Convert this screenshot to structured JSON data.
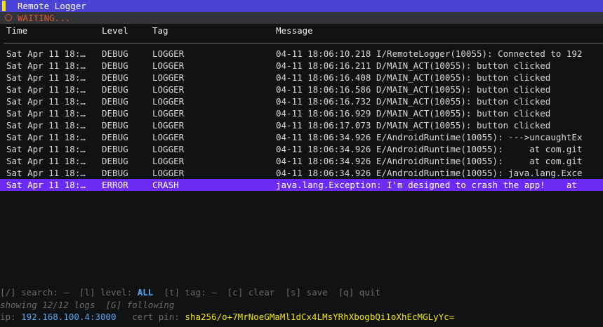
{
  "window": {
    "title": "Remote Logger"
  },
  "status": {
    "text": "WAITING..."
  },
  "columns": {
    "time": "Time",
    "level": "Level",
    "tag": "Tag",
    "message": "Message"
  },
  "rows": [
    {
      "time": "Sat Apr 11 18:…",
      "level": "DEBUG",
      "tag": "LOGGER",
      "message": "04-11 18:06:10.218 I/RemoteLogger(10055): Connected to 192"
    },
    {
      "time": "Sat Apr 11 18:…",
      "level": "DEBUG",
      "tag": "LOGGER",
      "message": "04-11 18:06:16.211 D/MAIN_ACT(10055): button clicked"
    },
    {
      "time": "Sat Apr 11 18:…",
      "level": "DEBUG",
      "tag": "LOGGER",
      "message": "04-11 18:06:16.408 D/MAIN_ACT(10055): button clicked"
    },
    {
      "time": "Sat Apr 11 18:…",
      "level": "DEBUG",
      "tag": "LOGGER",
      "message": "04-11 18:06:16.586 D/MAIN_ACT(10055): button clicked"
    },
    {
      "time": "Sat Apr 11 18:…",
      "level": "DEBUG",
      "tag": "LOGGER",
      "message": "04-11 18:06:16.732 D/MAIN_ACT(10055): button clicked"
    },
    {
      "time": "Sat Apr 11 18:…",
      "level": "DEBUG",
      "tag": "LOGGER",
      "message": "04-11 18:06:16.929 D/MAIN_ACT(10055): button clicked"
    },
    {
      "time": "Sat Apr 11 18:…",
      "level": "DEBUG",
      "tag": "LOGGER",
      "message": "04-11 18:06:17.073 D/MAIN_ACT(10055): button clicked"
    },
    {
      "time": "Sat Apr 11 18:…",
      "level": "DEBUG",
      "tag": "LOGGER",
      "message": "04-11 18:06:34.926 E/AndroidRuntime(10055): --->uncaughtEx"
    },
    {
      "time": "Sat Apr 11 18:…",
      "level": "DEBUG",
      "tag": "LOGGER",
      "message": "04-11 18:06:34.926 E/AndroidRuntime(10055):     at com.git"
    },
    {
      "time": "Sat Apr 11 18:…",
      "level": "DEBUG",
      "tag": "LOGGER",
      "message": "04-11 18:06:34.926 E/AndroidRuntime(10055):     at com.git"
    },
    {
      "time": "Sat Apr 11 18:…",
      "level": "DEBUG",
      "tag": "LOGGER",
      "message": "04-11 18:06:34.926 E/AndroidRuntime(10055): java.lang.Exce"
    },
    {
      "time": "Sat Apr 11 18:…",
      "level": "ERROR",
      "tag": "CRASH",
      "message": "java.lang.Exception: I'm designed to crash the app!    at",
      "selected": true
    }
  ],
  "footer": {
    "search_key": "[/] search: ",
    "search_value": "—",
    "level_key": "  [l] level: ",
    "level_value": "ALL",
    "tag_key": "  [t] tag: ",
    "tag_value": "—",
    "clear": "  [c] clear",
    "save": "  [s] save",
    "quit": "  [q] quit",
    "showing": "showing 12/12 logs  [G] following",
    "ip_label": "ip: ",
    "ip_value": "192.168.100.4:3000",
    "pin_label": "   cert pin: ",
    "pin_value": "sha256/o+7MrNoeGMaMl1dCx4LMsYRhXbogbQi1oXhEcMGLyYc="
  },
  "colors": {
    "title_bg": "#4b43d6",
    "accent": "#f2e600",
    "status": "#e05a2c",
    "selected_row": "#6c2bf2",
    "link_blue": "#5aa7f0"
  }
}
